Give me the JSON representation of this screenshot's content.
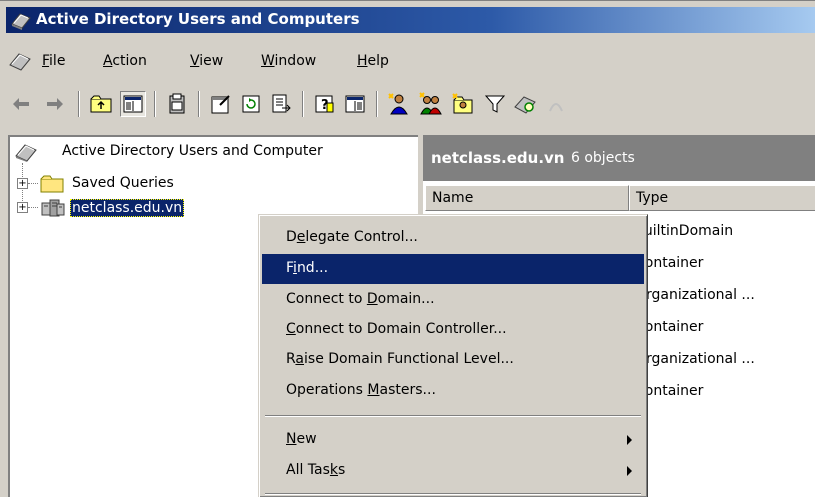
{
  "window": {
    "title": "Active Directory Users and Computers",
    "title_bar_color": "#0a246a"
  },
  "menubar": {
    "items": [
      {
        "pre": "",
        "key": "F",
        "post": "ile"
      },
      {
        "pre": "",
        "key": "A",
        "post": "ction"
      },
      {
        "pre": "",
        "key": "V",
        "post": "iew"
      },
      {
        "pre": "",
        "key": "W",
        "post": "indow"
      },
      {
        "pre": "",
        "key": "H",
        "post": "elp"
      }
    ]
  },
  "toolbar": {
    "icons": [
      "back-icon",
      "forward-icon",
      "up-folder-icon",
      "show-hide-console-tree-icon",
      "delete-icon",
      "properties-icon",
      "refresh-icon",
      "export-list-icon",
      "help-icon",
      "show-hide-action-pane-icon",
      "new-user-icon",
      "new-group-icon",
      "new-ou-icon",
      "filter-icon",
      "find-icon",
      "add-to-group-icon"
    ]
  },
  "tree": {
    "root": "Active Directory Users and Computer",
    "nodes": [
      {
        "label": "Saved Queries",
        "icon": "folder-icon"
      },
      {
        "label": "netclass.edu.vn",
        "icon": "domain-icon",
        "selected": true
      }
    ]
  },
  "details": {
    "title": "netclass.edu.vn",
    "count": "6 objects",
    "columns": [
      "Name",
      "Type"
    ],
    "type_values": [
      "builtinDomain",
      "Container",
      "Organizational ...",
      "Container",
      "Organizational ...",
      "Container"
    ]
  },
  "context_menu": {
    "items": [
      {
        "pre": "D",
        "key": "e",
        "post": "legate Control...",
        "highlight": false
      },
      {
        "pre": "F",
        "key": "i",
        "post": "nd...",
        "highlight": true
      },
      {
        "pre": "Connect to ",
        "key": "D",
        "post": "omain...",
        "highlight": false
      },
      {
        "pre": "",
        "key": "C",
        "post": "onnect to Domain Controller...",
        "highlight": false
      },
      {
        "pre": "R",
        "key": "a",
        "post": "ise Domain Functional Level...",
        "highlight": false
      },
      {
        "pre": "Operations ",
        "key": "M",
        "post": "asters...",
        "highlight": false
      },
      {
        "pre": "",
        "key": "N",
        "post": "ew",
        "highlight": false,
        "submenu": true
      },
      {
        "pre": "All Tas",
        "key": "k",
        "post": "s",
        "highlight": false,
        "submenu": true
      }
    ],
    "highlight_color": "#0a246a"
  }
}
